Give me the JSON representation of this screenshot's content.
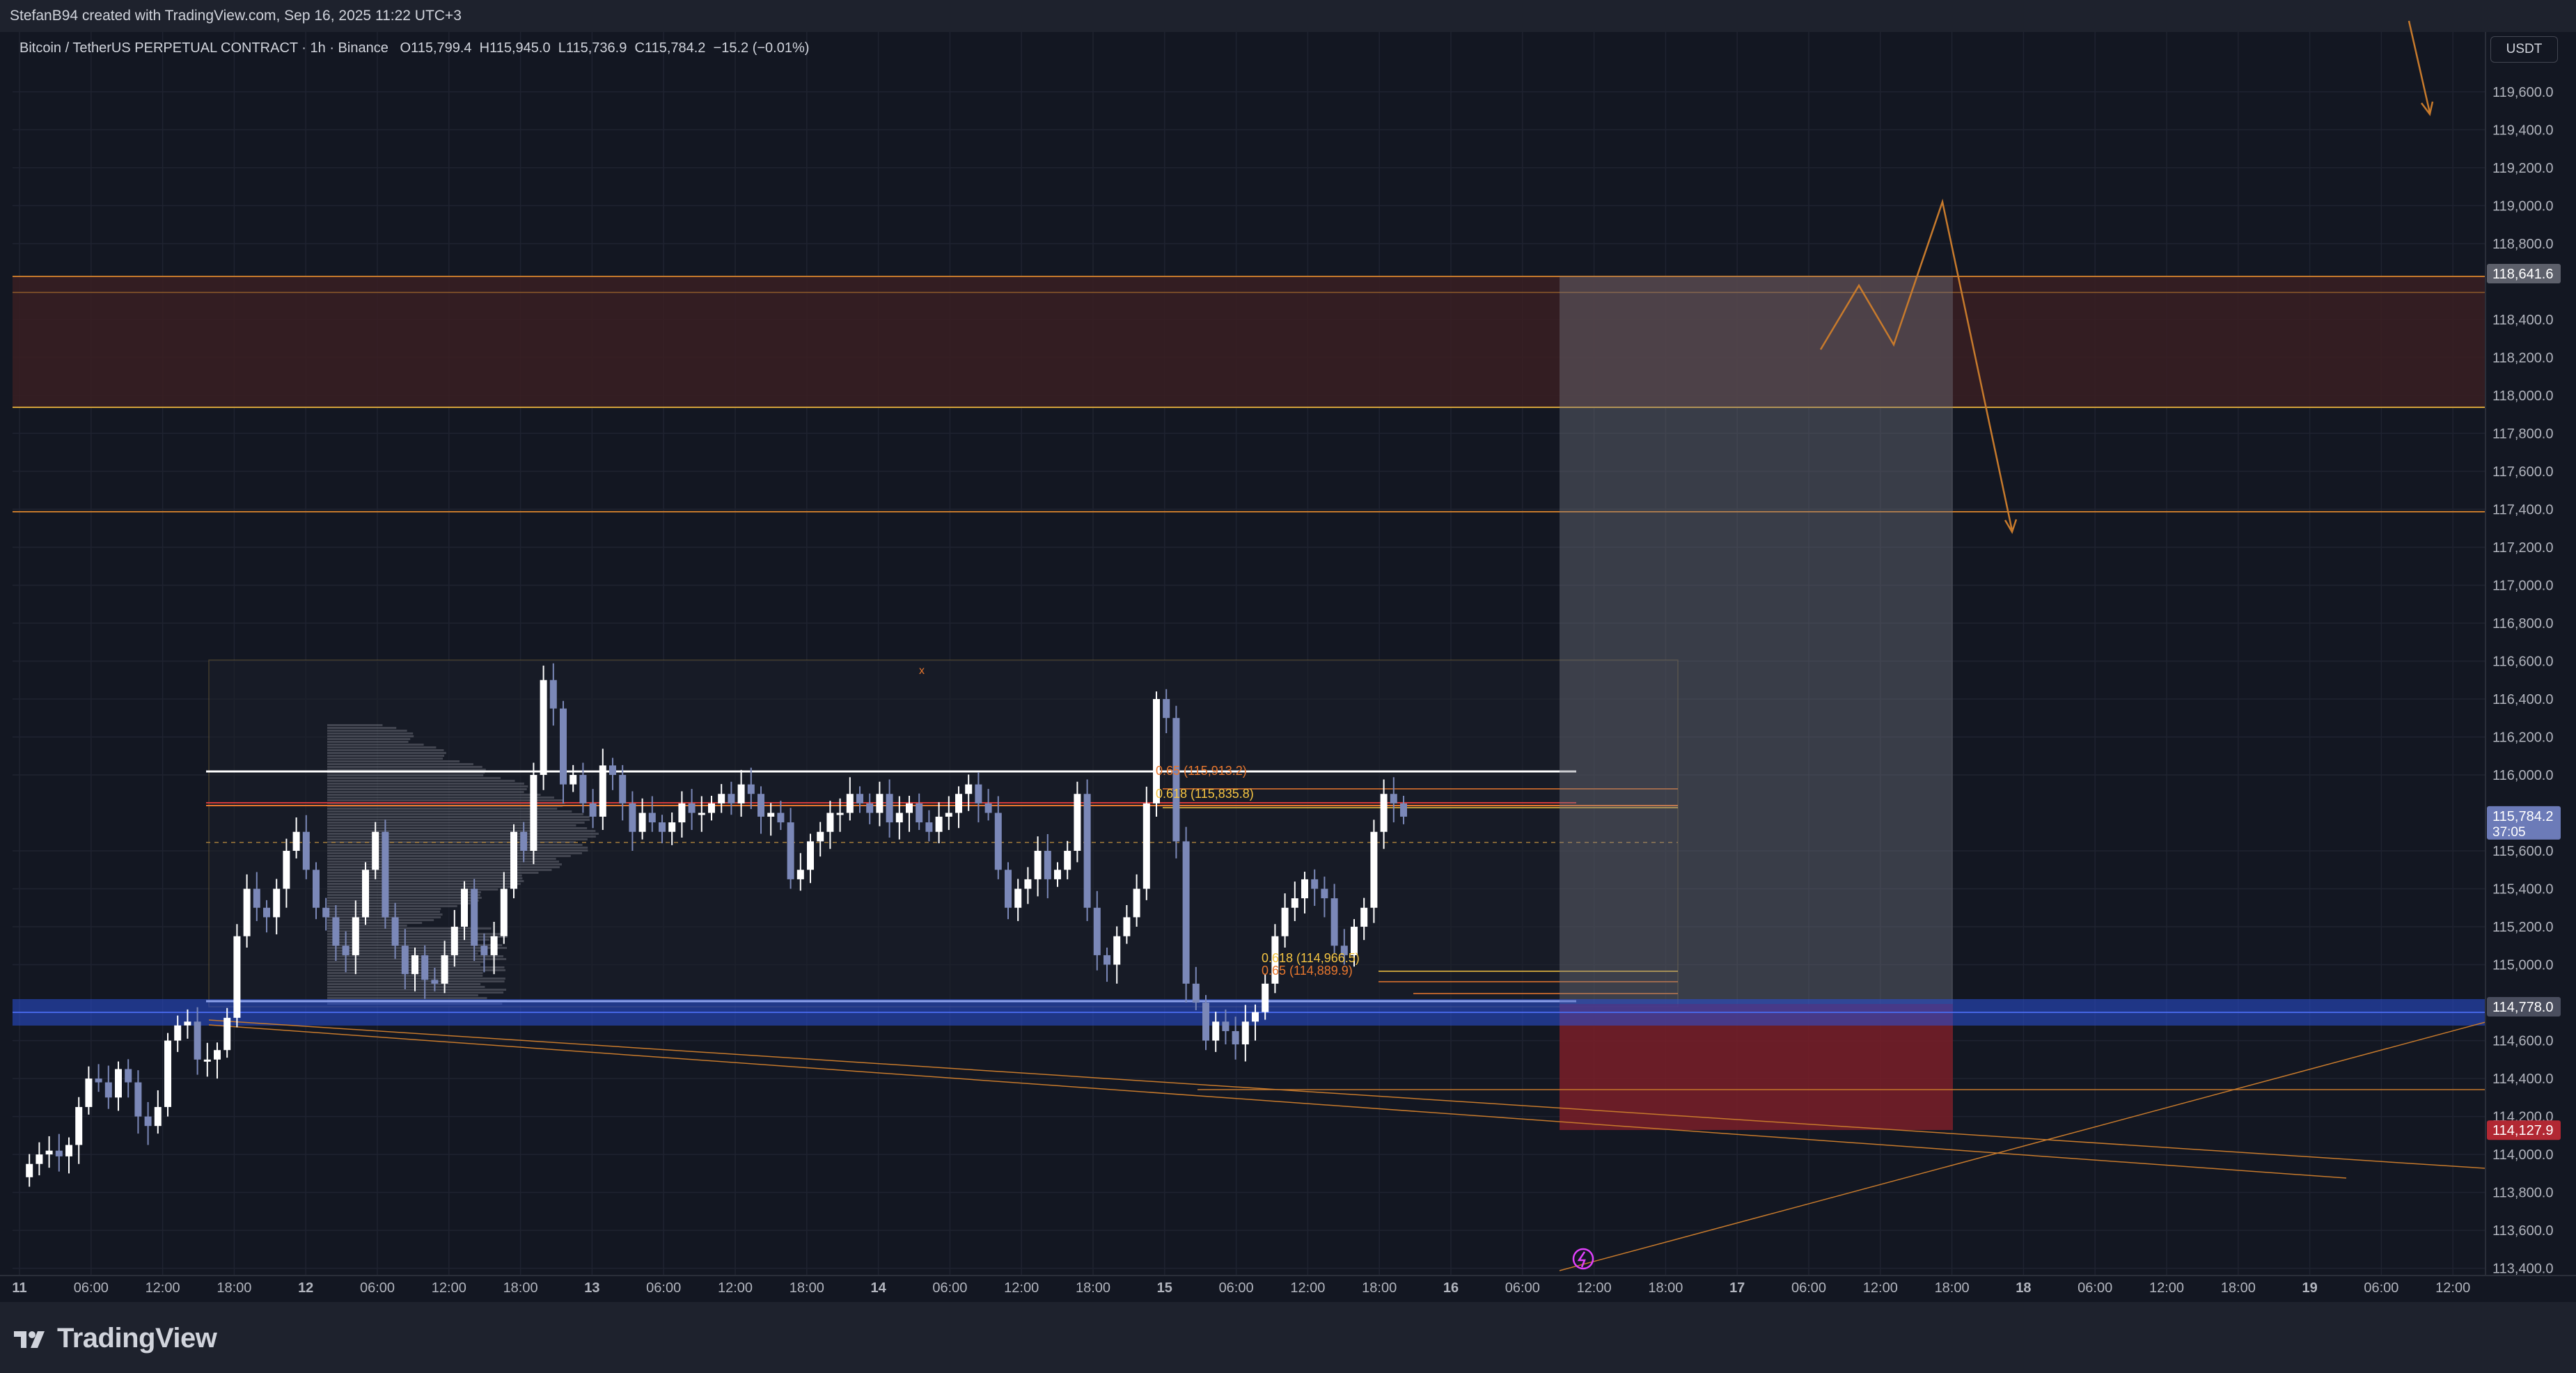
{
  "header": {
    "attribution": "StefanB94 created with TradingView.com, Sep 16, 2025 11:22 UTC+3"
  },
  "legend": {
    "symbol": "Bitcoin / TetherUS PERPETUAL CONTRACT · 1h · Binance",
    "open": "O115,799.4",
    "high": "H115,945.0",
    "low": "L115,736.9",
    "close": "C115,784.2",
    "change": "−15.2 (−0.01%)"
  },
  "currency_button": "USDT",
  "colors": {
    "bull": "#ffffff",
    "bear": "#7b88b8",
    "background": "#131722",
    "support_zone": "#2962ff",
    "resistance_zone": "#3a1f22",
    "projection": "#c77a2c"
  },
  "price_axis": {
    "labels": [
      "119,600.0",
      "119,400.0",
      "119,200.0",
      "119,000.0",
      "118,800.0",
      "118,400.0",
      "118,200.0",
      "118,000.0",
      "117,800.0",
      "117,600.0",
      "117,400.0",
      "117,200.0",
      "117,000.0",
      "116,800.0",
      "116,600.0",
      "116,400.0",
      "116,200.0",
      "116,000.0",
      "115,600.0",
      "115,400.0",
      "115,200.0",
      "115,000.0",
      "114,600.0",
      "114,400.0",
      "114,200.0",
      "114,000.0",
      "113,800.0",
      "113,600.0",
      "113,400.0"
    ],
    "tags": [
      {
        "text": "118,641.6",
        "color": "#5d606b"
      },
      {
        "text": "115,784.2",
        "sub": "37:05",
        "color": "#6c7bb8"
      },
      {
        "text": "114,778.0",
        "color": "#4a4e5e"
      },
      {
        "text": "114,127.9",
        "color": "#b22833"
      }
    ]
  },
  "time_axis": [
    "11",
    "06:00",
    "12:00",
    "18:00",
    "12",
    "06:00",
    "12:00",
    "18:00",
    "13",
    "06:00",
    "12:00",
    "18:00",
    "14",
    "06:00",
    "12:00",
    "18:00",
    "15",
    "06:00",
    "12:00",
    "18:00",
    "16",
    "06:00",
    "12:00",
    "18:00",
    "17",
    "06:00",
    "12:00",
    "18:00",
    "18",
    "06:00",
    "12:00",
    "18:00",
    "19",
    "06:00",
    "12:00"
  ],
  "fib_labels": [
    {
      "text": "0.618 (115,835.8)",
      "color": "#f5c542"
    },
    {
      "text": "0.65 (115,913.2)",
      "color": "#e8772e"
    },
    {
      "text": "0.618 (114,966.5)",
      "color": "#f5c542"
    },
    {
      "text": "0.65 (114,889.9)",
      "color": "#e8772e"
    }
  ],
  "marker_label": "x",
  "brand": "TradingView"
}
